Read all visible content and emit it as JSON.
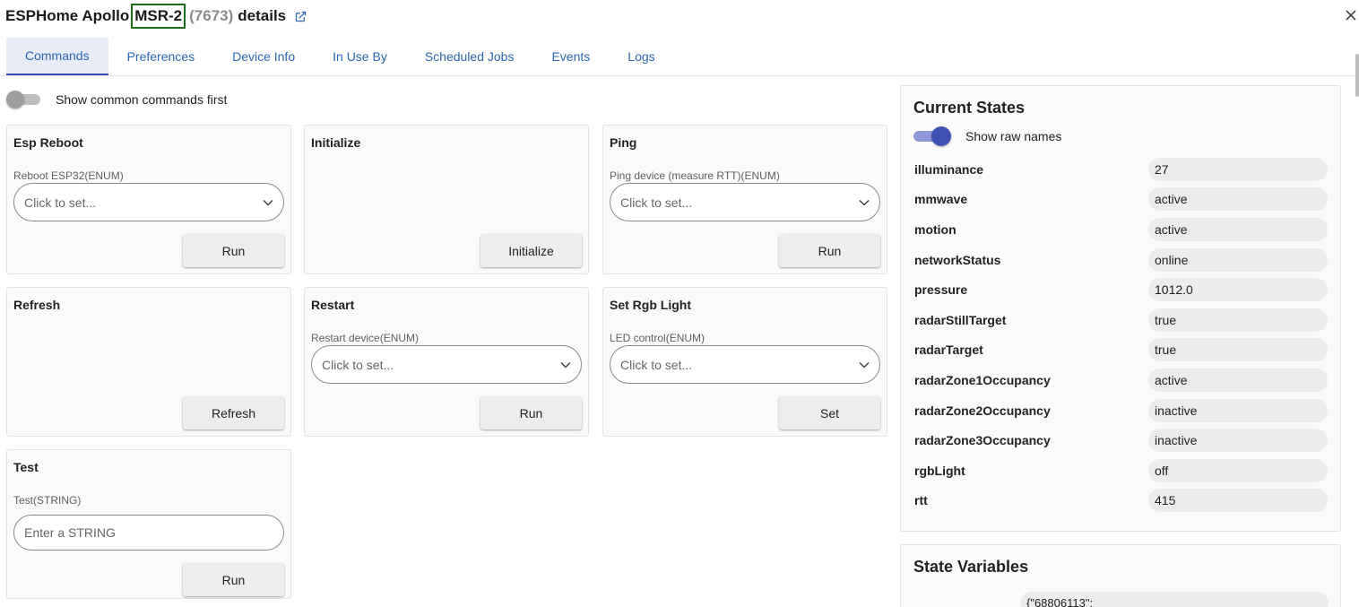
{
  "header": {
    "title_prefix": "ESPHome Apollo",
    "title_model": "MSR-2",
    "title_id": "(7673)",
    "title_suffix": "details"
  },
  "tabs": [
    {
      "label": "Commands",
      "active": true
    },
    {
      "label": "Preferences"
    },
    {
      "label": "Device Info"
    },
    {
      "label": "In Use By"
    },
    {
      "label": "Scheduled Jobs"
    },
    {
      "label": "Events"
    },
    {
      "label": "Logs"
    }
  ],
  "common_toggle": {
    "label": "Show common commands first",
    "on": false
  },
  "commands": [
    {
      "title": "Esp Reboot",
      "param": "Reboot ESP32(ENUM)",
      "placeholder": "Click to set...",
      "button": "Run"
    },
    {
      "title": "Initialize",
      "button": "Initialize"
    },
    {
      "title": "Ping",
      "param": "Ping device (measure RTT)(ENUM)",
      "placeholder": "Click to set...",
      "button": "Run"
    },
    {
      "title": "Refresh",
      "button": "Refresh"
    },
    {
      "title": "Restart",
      "param": "Restart device(ENUM)",
      "placeholder": "Click to set...",
      "button": "Run"
    },
    {
      "title": "Set Rgb Light",
      "param": "LED control(ENUM)",
      "placeholder": "Click to set...",
      "button": "Set"
    },
    {
      "title": "Test",
      "param": "Test(STRING)",
      "placeholder": "Enter a STRING",
      "button": "Run"
    }
  ],
  "current_states": {
    "title": "Current States",
    "raw_names_label": "Show raw names",
    "raw_names_on": true,
    "rows": [
      {
        "name": "illuminance",
        "value": "27"
      },
      {
        "name": "mmwave",
        "value": "active"
      },
      {
        "name": "motion",
        "value": "active"
      },
      {
        "name": "networkStatus",
        "value": "online"
      },
      {
        "name": "pressure",
        "value": "1012.0"
      },
      {
        "name": "radarStillTarget",
        "value": "true"
      },
      {
        "name": "radarTarget",
        "value": "true"
      },
      {
        "name": "radarZone1Occupancy",
        "value": "active"
      },
      {
        "name": "radarZone2Occupancy",
        "value": "inactive"
      },
      {
        "name": "radarZone3Occupancy",
        "value": "inactive"
      },
      {
        "name": "rgbLight",
        "value": "off"
      },
      {
        "name": "rtt",
        "value": "415"
      }
    ]
  },
  "state_variables": {
    "title": "State Variables",
    "first_value": "{\"68806113\":"
  },
  "icons": {
    "external_link": "external-link-icon",
    "close": "close-icon",
    "dropdown": "chevron-down-icon"
  },
  "colors": {
    "accent": "#3f51b5",
    "link": "#2a67b3",
    "highlight_border": "#1b6e1b"
  }
}
